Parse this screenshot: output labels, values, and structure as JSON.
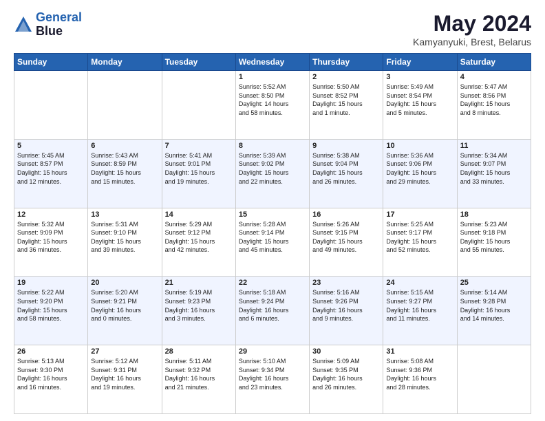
{
  "header": {
    "logo_line1": "General",
    "logo_line2": "Blue",
    "title": "May 2024",
    "subtitle": "Kamyanyuki, Brest, Belarus"
  },
  "weekdays": [
    "Sunday",
    "Monday",
    "Tuesday",
    "Wednesday",
    "Thursday",
    "Friday",
    "Saturday"
  ],
  "rows": [
    [
      {
        "date": "",
        "info": ""
      },
      {
        "date": "",
        "info": ""
      },
      {
        "date": "",
        "info": ""
      },
      {
        "date": "1",
        "info": "Sunrise: 5:52 AM\nSunset: 8:50 PM\nDaylight: 14 hours\nand 58 minutes."
      },
      {
        "date": "2",
        "info": "Sunrise: 5:50 AM\nSunset: 8:52 PM\nDaylight: 15 hours\nand 1 minute."
      },
      {
        "date": "3",
        "info": "Sunrise: 5:49 AM\nSunset: 8:54 PM\nDaylight: 15 hours\nand 5 minutes."
      },
      {
        "date": "4",
        "info": "Sunrise: 5:47 AM\nSunset: 8:56 PM\nDaylight: 15 hours\nand 8 minutes."
      }
    ],
    [
      {
        "date": "5",
        "info": "Sunrise: 5:45 AM\nSunset: 8:57 PM\nDaylight: 15 hours\nand 12 minutes."
      },
      {
        "date": "6",
        "info": "Sunrise: 5:43 AM\nSunset: 8:59 PM\nDaylight: 15 hours\nand 15 minutes."
      },
      {
        "date": "7",
        "info": "Sunrise: 5:41 AM\nSunset: 9:01 PM\nDaylight: 15 hours\nand 19 minutes."
      },
      {
        "date": "8",
        "info": "Sunrise: 5:39 AM\nSunset: 9:02 PM\nDaylight: 15 hours\nand 22 minutes."
      },
      {
        "date": "9",
        "info": "Sunrise: 5:38 AM\nSunset: 9:04 PM\nDaylight: 15 hours\nand 26 minutes."
      },
      {
        "date": "10",
        "info": "Sunrise: 5:36 AM\nSunset: 9:06 PM\nDaylight: 15 hours\nand 29 minutes."
      },
      {
        "date": "11",
        "info": "Sunrise: 5:34 AM\nSunset: 9:07 PM\nDaylight: 15 hours\nand 33 minutes."
      }
    ],
    [
      {
        "date": "12",
        "info": "Sunrise: 5:32 AM\nSunset: 9:09 PM\nDaylight: 15 hours\nand 36 minutes."
      },
      {
        "date": "13",
        "info": "Sunrise: 5:31 AM\nSunset: 9:10 PM\nDaylight: 15 hours\nand 39 minutes."
      },
      {
        "date": "14",
        "info": "Sunrise: 5:29 AM\nSunset: 9:12 PM\nDaylight: 15 hours\nand 42 minutes."
      },
      {
        "date": "15",
        "info": "Sunrise: 5:28 AM\nSunset: 9:14 PM\nDaylight: 15 hours\nand 45 minutes."
      },
      {
        "date": "16",
        "info": "Sunrise: 5:26 AM\nSunset: 9:15 PM\nDaylight: 15 hours\nand 49 minutes."
      },
      {
        "date": "17",
        "info": "Sunrise: 5:25 AM\nSunset: 9:17 PM\nDaylight: 15 hours\nand 52 minutes."
      },
      {
        "date": "18",
        "info": "Sunrise: 5:23 AM\nSunset: 9:18 PM\nDaylight: 15 hours\nand 55 minutes."
      }
    ],
    [
      {
        "date": "19",
        "info": "Sunrise: 5:22 AM\nSunset: 9:20 PM\nDaylight: 15 hours\nand 58 minutes."
      },
      {
        "date": "20",
        "info": "Sunrise: 5:20 AM\nSunset: 9:21 PM\nDaylight: 16 hours\nand 0 minutes."
      },
      {
        "date": "21",
        "info": "Sunrise: 5:19 AM\nSunset: 9:23 PM\nDaylight: 16 hours\nand 3 minutes."
      },
      {
        "date": "22",
        "info": "Sunrise: 5:18 AM\nSunset: 9:24 PM\nDaylight: 16 hours\nand 6 minutes."
      },
      {
        "date": "23",
        "info": "Sunrise: 5:16 AM\nSunset: 9:26 PM\nDaylight: 16 hours\nand 9 minutes."
      },
      {
        "date": "24",
        "info": "Sunrise: 5:15 AM\nSunset: 9:27 PM\nDaylight: 16 hours\nand 11 minutes."
      },
      {
        "date": "25",
        "info": "Sunrise: 5:14 AM\nSunset: 9:28 PM\nDaylight: 16 hours\nand 14 minutes."
      }
    ],
    [
      {
        "date": "26",
        "info": "Sunrise: 5:13 AM\nSunset: 9:30 PM\nDaylight: 16 hours\nand 16 minutes."
      },
      {
        "date": "27",
        "info": "Sunrise: 5:12 AM\nSunset: 9:31 PM\nDaylight: 16 hours\nand 19 minutes."
      },
      {
        "date": "28",
        "info": "Sunrise: 5:11 AM\nSunset: 9:32 PM\nDaylight: 16 hours\nand 21 minutes."
      },
      {
        "date": "29",
        "info": "Sunrise: 5:10 AM\nSunset: 9:34 PM\nDaylight: 16 hours\nand 23 minutes."
      },
      {
        "date": "30",
        "info": "Sunrise: 5:09 AM\nSunset: 9:35 PM\nDaylight: 16 hours\nand 26 minutes."
      },
      {
        "date": "31",
        "info": "Sunrise: 5:08 AM\nSunset: 9:36 PM\nDaylight: 16 hours\nand 28 minutes."
      },
      {
        "date": "",
        "info": ""
      }
    ]
  ]
}
